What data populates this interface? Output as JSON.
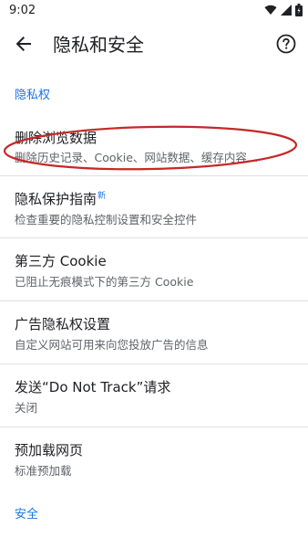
{
  "status": {
    "time": "9:02"
  },
  "header": {
    "title": "隐私和安全"
  },
  "sections": {
    "privacy": "隐私权",
    "security": "安全"
  },
  "items": [
    {
      "title": "删除浏览数据",
      "subtitle": "删除历史记录、Cookie、网站数据、缓存内容…"
    },
    {
      "title": "隐私保护指南",
      "badge": "新",
      "subtitle": "检查重要的隐私控制设置和安全控件"
    },
    {
      "title": "第三方 Cookie",
      "subtitle": "已阻止无痕模式下的第三方 Cookie"
    },
    {
      "title": "广告隐私权设置",
      "subtitle": "自定义网站可用来向您投放广告的信息"
    },
    {
      "title": "发送“Do Not Track”请求",
      "subtitle": "关闭"
    },
    {
      "title": "预加载网页",
      "subtitle": "标准预加载"
    }
  ],
  "colors": {
    "accent": "#1a73e8",
    "annotation": "#c62828"
  }
}
